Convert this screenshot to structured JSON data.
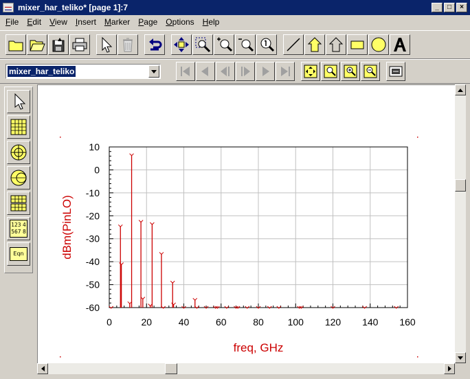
{
  "window": {
    "title": "mixer_har_teliko* [page 1]:7",
    "controls": {
      "minimize": "_",
      "maximize": "□",
      "close": "×"
    }
  },
  "menu": [
    {
      "label": "File",
      "accel": "F",
      "rest": "ile"
    },
    {
      "label": "Edit",
      "accel": "E",
      "rest": "dit"
    },
    {
      "label": "View",
      "accel": "V",
      "rest": "iew"
    },
    {
      "label": "Insert",
      "accel": "I",
      "rest": "nsert"
    },
    {
      "label": "Marker",
      "accel": "M",
      "rest": "arker"
    },
    {
      "label": "Page",
      "accel": "P",
      "rest": "age"
    },
    {
      "label": "Options",
      "accel": "O",
      "rest": "ptions"
    },
    {
      "label": "Help",
      "accel": "H",
      "rest": "elp"
    }
  ],
  "toolbar": {
    "dataset_combo": {
      "value": "mixer_har_teliko"
    }
  },
  "palette": {
    "numeric_label": "123 4 567 8",
    "equation_label": "Eqn"
  },
  "colors": {
    "trace": "#cc0000",
    "axis_text": "#cc0000",
    "grid": "#c0c0c0",
    "marker_yellow": "#ffff66",
    "selection": "#0a246a"
  },
  "chart_data": {
    "type": "bar",
    "xlabel": "freq, GHz",
    "ylabel": "dBm(PinLO)",
    "xlim": [
      0,
      160
    ],
    "ylim": [
      -60,
      10
    ],
    "xticks": [
      0,
      20,
      40,
      60,
      80,
      100,
      120,
      140,
      160
    ],
    "yticks": [
      10,
      0,
      -10,
      -20,
      -30,
      -40,
      -50,
      -60
    ],
    "grid": true,
    "baseline": -60,
    "x": [
      1,
      6,
      6.5,
      11,
      12,
      17,
      18,
      22,
      23,
      28,
      29,
      34,
      34.5,
      40,
      46,
      47,
      52,
      57,
      58,
      63,
      68,
      69,
      74,
      80,
      86,
      91,
      102,
      103,
      120,
      137,
      154
    ],
    "y": [
      -60,
      -24.5,
      -41,
      -58,
      6.5,
      -22.5,
      -56,
      -59,
      -23.5,
      -36.5,
      -60,
      -49,
      -58.5,
      -60,
      -56.5,
      -60,
      -60,
      -60,
      -60,
      -60,
      -60,
      -60,
      -60,
      -60,
      -60,
      -60,
      -60,
      -60,
      -60,
      -60,
      -60
    ]
  }
}
